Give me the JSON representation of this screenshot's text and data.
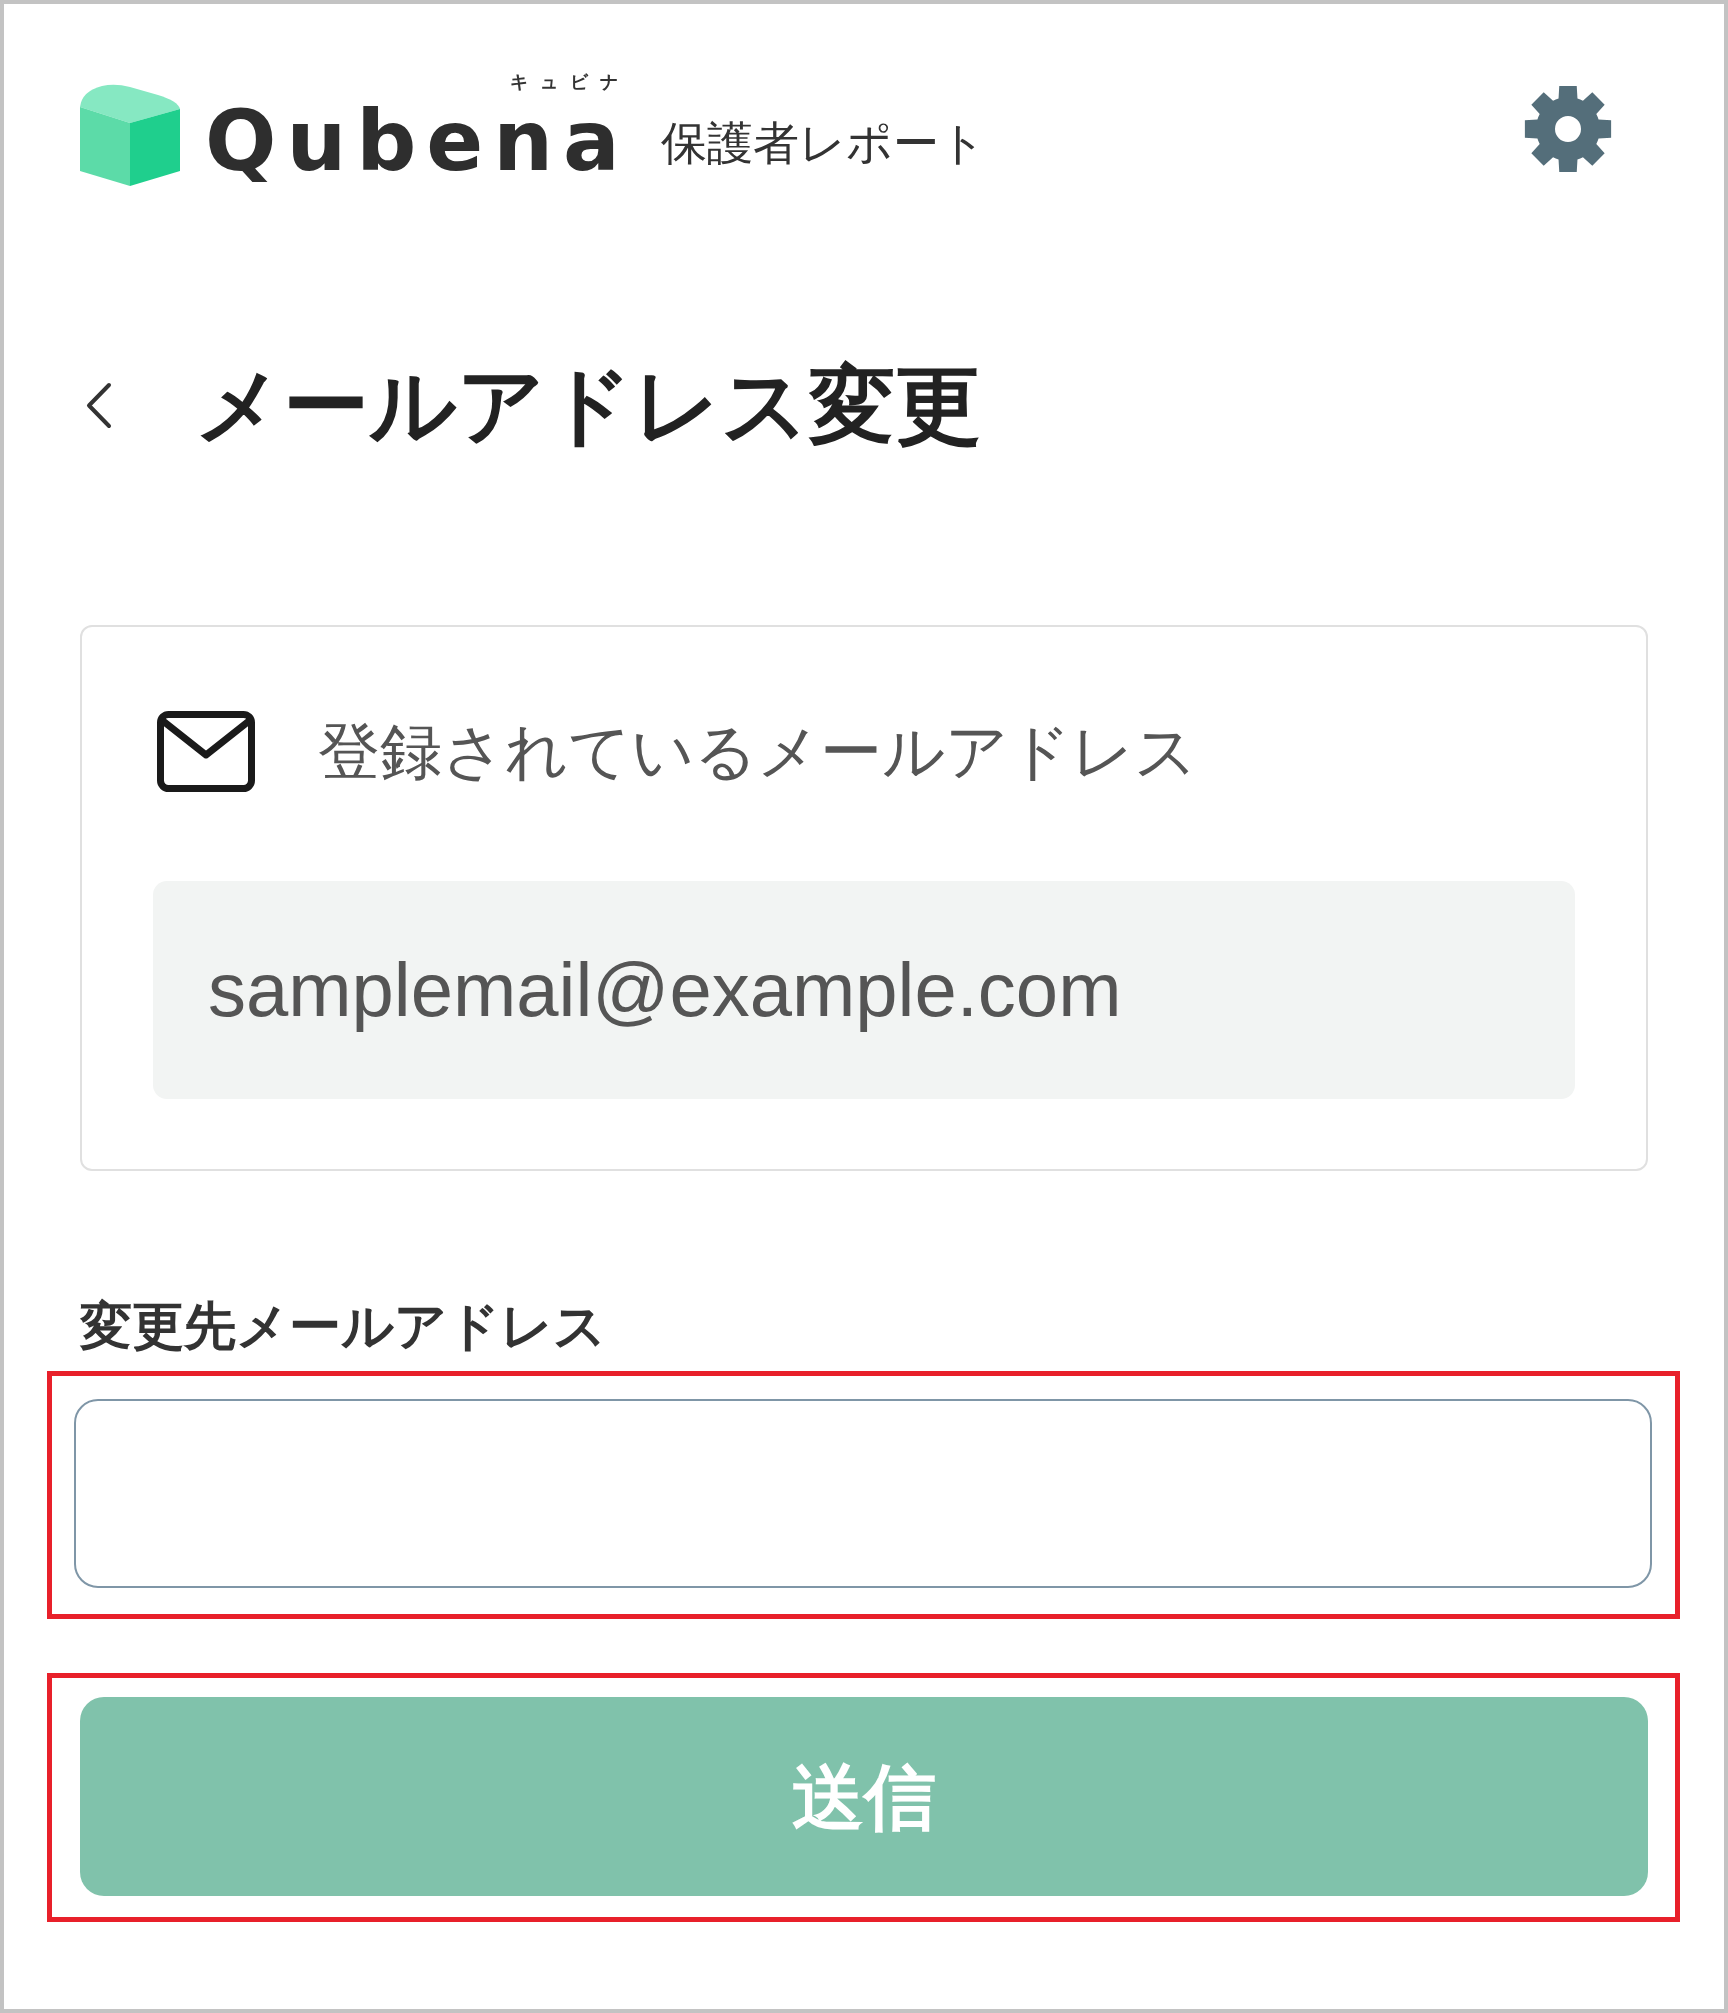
{
  "header": {
    "logo": {
      "reading": "キュビナ",
      "wordmark": "Qubena"
    },
    "subtitle": "保護者レポート"
  },
  "page": {
    "title": "メールアドレス変更"
  },
  "current_email": {
    "label": "登録されているメールアドレス",
    "value": "samplemail@example.com"
  },
  "new_email": {
    "label": "変更先メールアドレス",
    "highlighted": true
  },
  "submit_button": {
    "label": "送信",
    "highlighted": true
  }
}
